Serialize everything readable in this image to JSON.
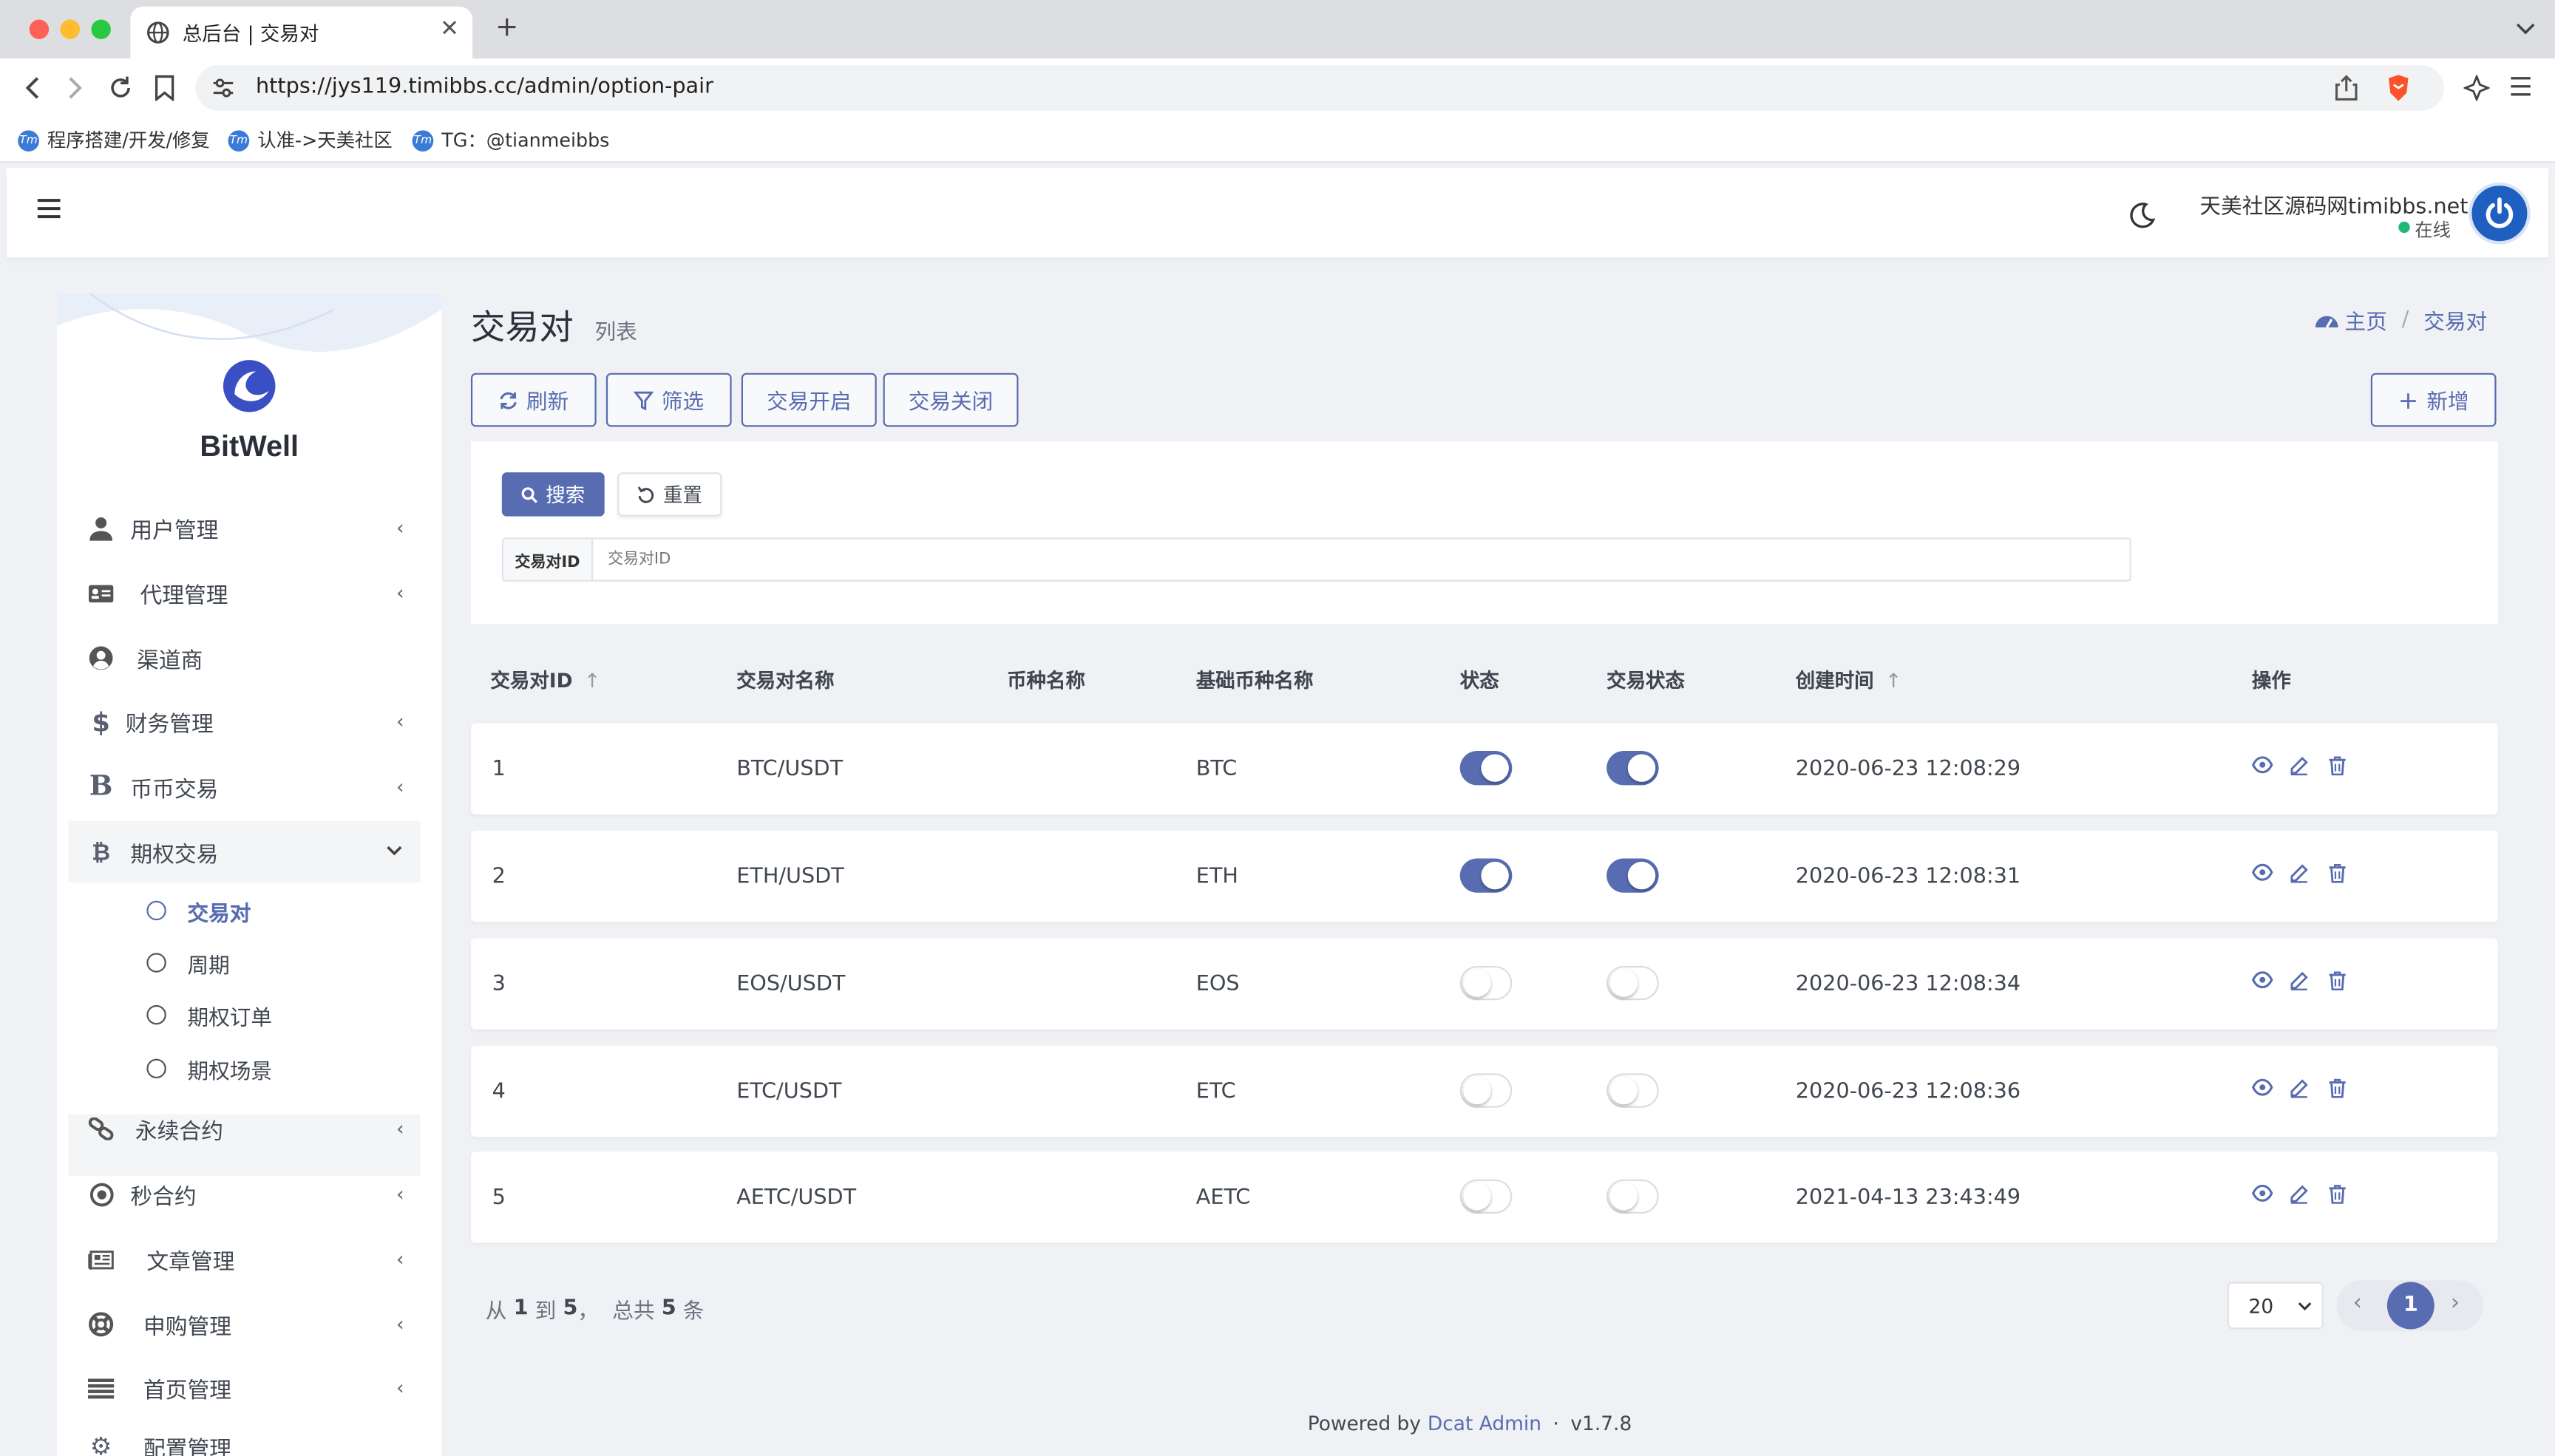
{
  "browser": {
    "tab_title": "总后台 | 交易对",
    "url": "https://jys119.timibbs.cc/admin/option-pair",
    "bookmarks": [
      "程序搭建/开发/修复",
      "认准->天美社区",
      "TG：@tianmeibbs"
    ]
  },
  "header": {
    "user_name": "天美社区源码网timibbs.net",
    "status": "在线"
  },
  "sidebar": {
    "brand": "BitWell",
    "items": [
      {
        "label": "用户管理",
        "icon": "user-tie-icon"
      },
      {
        "label": "代理管理",
        "icon": "id-card-icon"
      },
      {
        "label": "渠道商",
        "icon": "user-circle-icon"
      },
      {
        "label": "财务管理",
        "icon": "dollar-icon"
      },
      {
        "label": "币币交易",
        "icon": "letter-b-icon"
      },
      {
        "label": "期权交易",
        "icon": "bitcoin-icon"
      },
      {
        "label": "永续合约",
        "icon": "link-icon"
      },
      {
        "label": "秒合约",
        "icon": "dot-circle-icon"
      },
      {
        "label": "文章管理",
        "icon": "newspaper-icon"
      },
      {
        "label": "申购管理",
        "icon": "life-ring-icon"
      },
      {
        "label": "首页管理",
        "icon": "list-icon"
      },
      {
        "label": "配置管理",
        "icon": "cog-icon"
      }
    ],
    "sub_items": [
      "交易对",
      "周期",
      "期权订单",
      "期权场景"
    ]
  },
  "page": {
    "title": "交易对",
    "subtitle": "列表",
    "breadcrumb_home": "主页",
    "breadcrumb_current": "交易对"
  },
  "toolbar": {
    "refresh": "刷新",
    "filter": "筛选",
    "trade_open": "交易开启",
    "trade_close": "交易关闭",
    "create": "新增"
  },
  "filter": {
    "search": "搜索",
    "reset": "重置",
    "field_label": "交易对ID",
    "field_placeholder": "交易对ID",
    "field_value": ""
  },
  "table": {
    "columns": [
      "交易对ID",
      "交易对名称",
      "币种名称",
      "基础币种名称",
      "状态",
      "交易状态",
      "创建时间",
      "操作"
    ],
    "rows": [
      {
        "id": "1",
        "name": "BTC/USDT",
        "currency": "",
        "base": "BTC",
        "status": true,
        "trade_status": true,
        "created": "2020-06-23 12:08:29"
      },
      {
        "id": "2",
        "name": "ETH/USDT",
        "currency": "",
        "base": "ETH",
        "status": true,
        "trade_status": true,
        "created": "2020-06-23 12:08:31"
      },
      {
        "id": "3",
        "name": "EOS/USDT",
        "currency": "",
        "base": "EOS",
        "status": false,
        "trade_status": false,
        "created": "2020-06-23 12:08:34"
      },
      {
        "id": "4",
        "name": "ETC/USDT",
        "currency": "",
        "base": "ETC",
        "status": false,
        "trade_status": false,
        "created": "2020-06-23 12:08:36"
      },
      {
        "id": "5",
        "name": "AETC/USDT",
        "currency": "",
        "base": "AETC",
        "status": false,
        "trade_status": false,
        "created": "2021-04-13 23:43:49"
      }
    ]
  },
  "pagination": {
    "summary_prefix": "从",
    "from": "1",
    "to_word": "到",
    "to": "5",
    "total_prefix": "，  总共",
    "total": "5",
    "total_suffix": "条",
    "per_page": "20",
    "current_page": "1"
  },
  "footer": {
    "powered_by": "Powered by",
    "brand": "Dcat Admin",
    "separator": "·",
    "version": "v1.7.8"
  },
  "colors": {
    "primary": "#586cb1",
    "online": "#21b978",
    "background": "#eff1f4"
  }
}
